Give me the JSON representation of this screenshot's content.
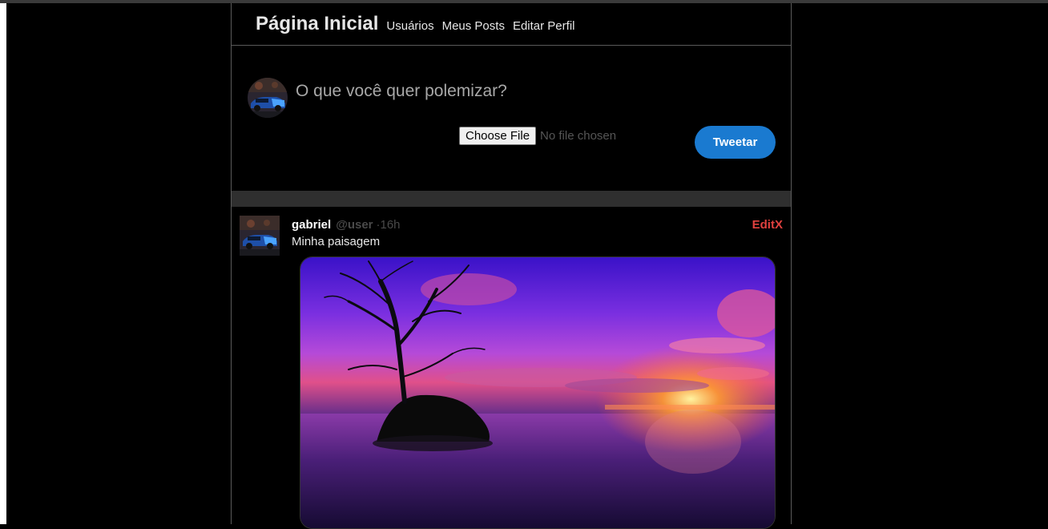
{
  "nav": {
    "title": "Página Inicial",
    "links": [
      "Usuários",
      "Meus Posts",
      "Editar Perfil"
    ]
  },
  "composer": {
    "placeholder": "O que você quer polemizar?",
    "file_button": "Choose File",
    "file_status": "No file chosen",
    "tweet_button": "Tweetar"
  },
  "post": {
    "author": "gabriel",
    "handle": "@user",
    "separator": "·",
    "time": "16h",
    "edit_label": "Edit",
    "delete_label": "X",
    "text": "Minha paisagem"
  },
  "colors": {
    "accent": "#1a7ad0",
    "danger": "#e0413f",
    "background": "#000000"
  }
}
